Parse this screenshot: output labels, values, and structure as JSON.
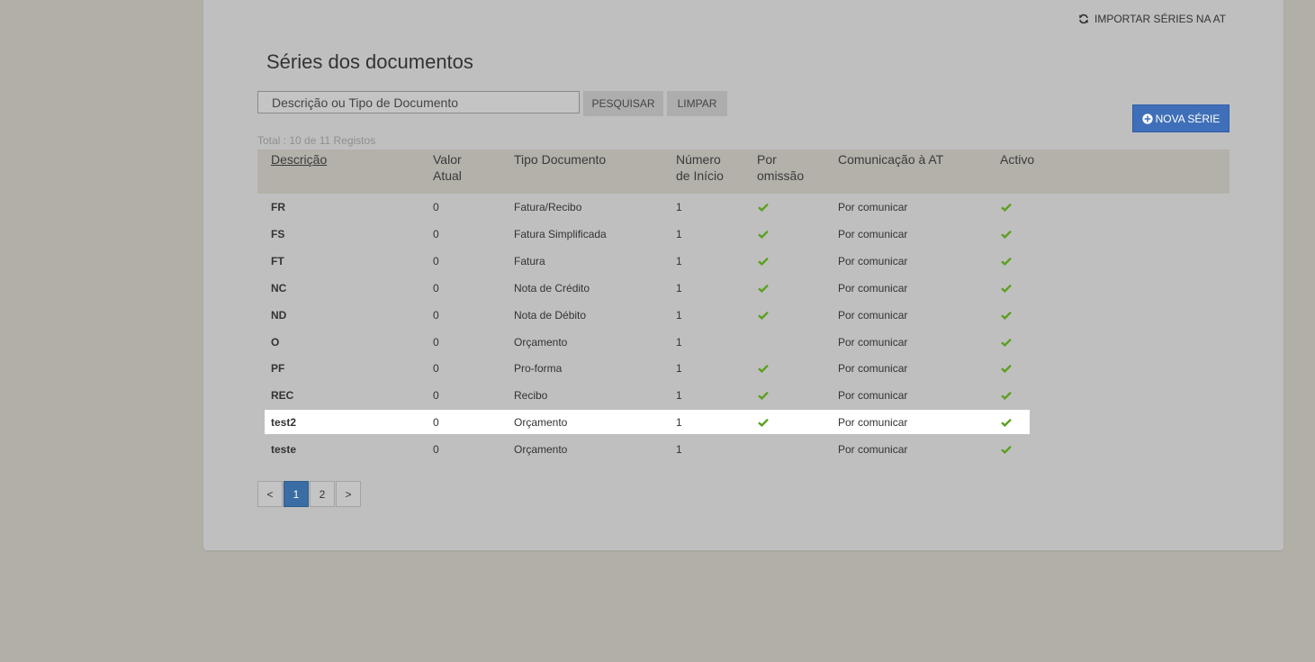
{
  "header": {
    "import_label": "IMPORTAR SÉRIES NA AT",
    "title": "Séries dos documentos"
  },
  "search": {
    "placeholder": "Descrição ou Tipo de Documento",
    "search_label": "PESQUISAR",
    "clear_label": "LIMPAR"
  },
  "new_series_label": "NOVA SÉRIE",
  "total_label": "Total : 10 de 11 Registos",
  "columns": {
    "descricao": "Descrição",
    "valor_atual_1": "Valor",
    "valor_atual_2": "Atual",
    "tipo_documento": "Tipo Documento",
    "numero_inicio_1": "Número",
    "numero_inicio_2": "de Início",
    "por_omissao_1": "Por",
    "por_omissao_2": "omissão",
    "comunicacao_at": "Comunicação à AT",
    "activo": "Activo"
  },
  "rows": [
    {
      "descricao": "FR",
      "valor_atual": "0",
      "tipo_documento": "Fatura/Recibo",
      "numero_inicio": "1",
      "por_omissao": true,
      "comunicacao_at": "Por comunicar",
      "activo": true
    },
    {
      "descricao": "FS",
      "valor_atual": "0",
      "tipo_documento": "Fatura Simplificada",
      "numero_inicio": "1",
      "por_omissao": true,
      "comunicacao_at": "Por comunicar",
      "activo": true
    },
    {
      "descricao": "FT",
      "valor_atual": "0",
      "tipo_documento": "Fatura",
      "numero_inicio": "1",
      "por_omissao": true,
      "comunicacao_at": "Por comunicar",
      "activo": true
    },
    {
      "descricao": "NC",
      "valor_atual": "0",
      "tipo_documento": "Nota de Crédito",
      "numero_inicio": "1",
      "por_omissao": true,
      "comunicacao_at": "Por comunicar",
      "activo": true
    },
    {
      "descricao": "ND",
      "valor_atual": "0",
      "tipo_documento": "Nota de Débito",
      "numero_inicio": "1",
      "por_omissao": true,
      "comunicacao_at": "Por comunicar",
      "activo": true
    },
    {
      "descricao": "O",
      "valor_atual": "0",
      "tipo_documento": "Orçamento",
      "numero_inicio": "1",
      "por_omissao": false,
      "comunicacao_at": "Por comunicar",
      "activo": true
    },
    {
      "descricao": "PF",
      "valor_atual": "0",
      "tipo_documento": "Pro-forma",
      "numero_inicio": "1",
      "por_omissao": true,
      "comunicacao_at": "Por comunicar",
      "activo": true
    },
    {
      "descricao": "REC",
      "valor_atual": "0",
      "tipo_documento": "Recibo",
      "numero_inicio": "1",
      "por_omissao": true,
      "comunicacao_at": "Por comunicar",
      "activo": true
    },
    {
      "descricao": "test2",
      "valor_atual": "0",
      "tipo_documento": "Orçamento",
      "numero_inicio": "1",
      "por_omissao": true,
      "comunicacao_at": "Por comunicar",
      "activo": true,
      "highlighted": true
    },
    {
      "descricao": "teste",
      "valor_atual": "0",
      "tipo_documento": "Orçamento",
      "numero_inicio": "1",
      "por_omissao": false,
      "comunicacao_at": "Por comunicar",
      "activo": true
    }
  ],
  "pagination": {
    "prev": "<",
    "pages": [
      "1",
      "2"
    ],
    "current": "1",
    "next": ">"
  },
  "colors": {
    "check": "#5aa01e",
    "primary": "#3f6fb8",
    "active_page": "#3a6da3"
  },
  "icons": {
    "import": "refresh-icon",
    "new": "plus-circle-icon",
    "check": "check-icon"
  }
}
